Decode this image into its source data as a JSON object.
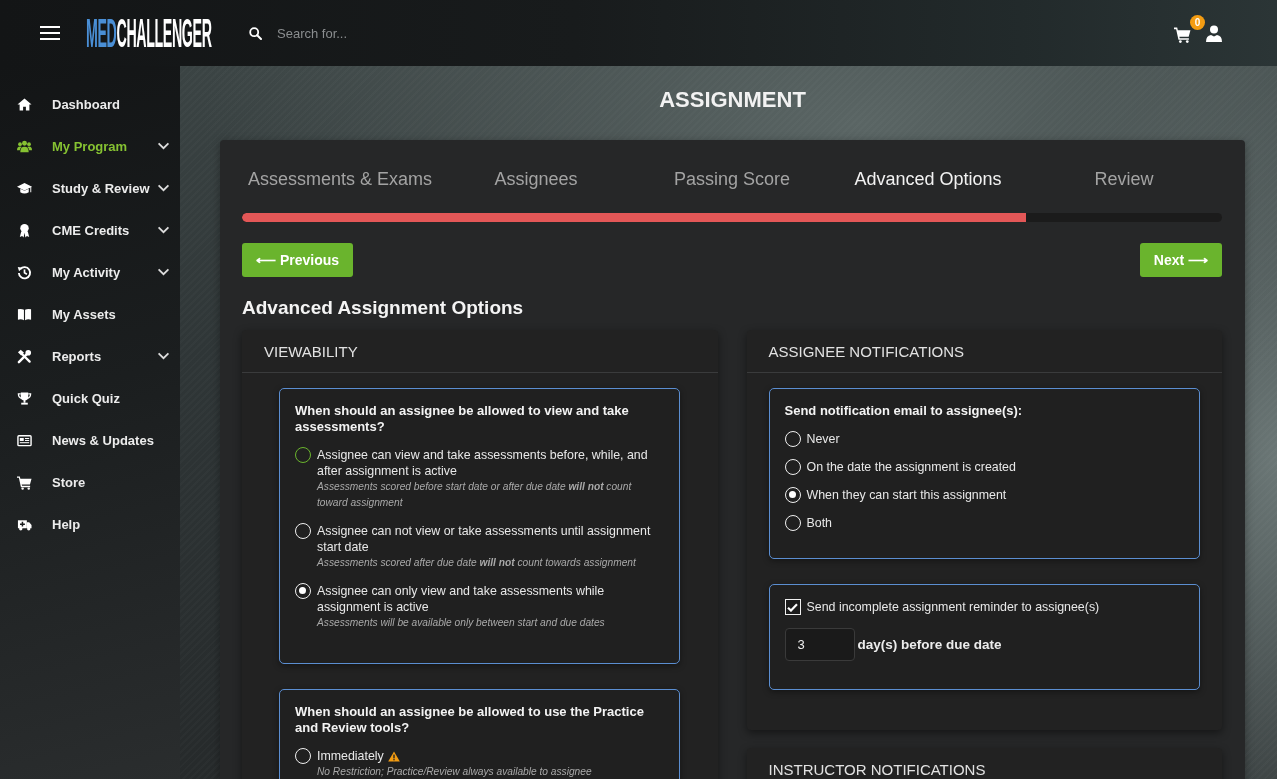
{
  "header": {
    "logo": {
      "prefix": "MED",
      "name": "CHALLENGER"
    },
    "search": {
      "placeholder": "Search for..."
    },
    "cart_badge": "0"
  },
  "sidebar": {
    "items": [
      {
        "label": "Dashboard",
        "selected": false,
        "expandable": false
      },
      {
        "label": "My Program",
        "selected": true,
        "expandable": true
      },
      {
        "label": "Study & Review",
        "selected": false,
        "expandable": true
      },
      {
        "label": "CME Credits",
        "selected": false,
        "expandable": true
      },
      {
        "label": "My Activity",
        "selected": false,
        "expandable": true
      },
      {
        "label": "My Assets",
        "selected": false,
        "expandable": false
      },
      {
        "label": "Reports",
        "selected": false,
        "expandable": true
      },
      {
        "label": "Quick Quiz",
        "selected": false,
        "expandable": false
      },
      {
        "label": "News & Updates",
        "selected": false,
        "expandable": false
      },
      {
        "label": "Store",
        "selected": false,
        "expandable": false
      },
      {
        "label": "Help",
        "selected": false,
        "expandable": false
      }
    ]
  },
  "page_title": "ASSIGNMENT",
  "wizard": {
    "tabs": [
      {
        "label": "Assessments & Exams",
        "selected": false
      },
      {
        "label": "Assignees",
        "selected": false
      },
      {
        "label": "Passing Score",
        "selected": false
      },
      {
        "label": "Advanced Options",
        "selected": true
      },
      {
        "label": "Review",
        "selected": false
      }
    ],
    "progress": {
      "level": 0.8
    },
    "previous_button": "⟵ Previous",
    "next_button": "Next ⟶"
  },
  "section_title": "Advanced Assignment Options",
  "columns": [
    {
      "panels": [
        {
          "title": "VIEWABILITY",
          "groups": [
            {
              "kind": "radio_group",
              "question": "When should an assignee be allowed to view and take assessments?",
              "options": [
                {
                  "label": "Assignee can view and take assessments before, while, and after assignment is active",
                  "note": "Assessments scored before start date or after due date **will not** count toward assignment",
                  "selected": false,
                  "color": "#6ab42d",
                  "warning": false
                },
                {
                  "label": "Assignee can not view or take assessments until assignment start date",
                  "note": "Assessments scored after due date **will not** count towards assignment",
                  "selected": false,
                  "color": "#f0f0f0",
                  "warning": false
                },
                {
                  "label": "Assignee can only view and take assessments while assignment is active",
                  "note": "Assessments will be available only between start and due dates",
                  "selected": true,
                  "color": "#f0f0f0",
                  "warning": false
                }
              ]
            },
            {
              "kind": "radio_group",
              "question": "When should an assignee be allowed to use the Practice and Review tools?",
              "options": [
                {
                  "label": "Immediately",
                  "note": "No Restriction; Practice/Review always available to assignee",
                  "selected": false,
                  "color": "#f0f0f0",
                  "warning": true
                }
              ]
            }
          ]
        }
      ]
    },
    {
      "panels": [
        {
          "title": "ASSIGNEE NOTIFICATIONS",
          "groups": [
            {
              "kind": "radio_group",
              "question": "Send notification email to assignee(s):",
              "options": [
                {
                  "label": "Never",
                  "selected": false,
                  "color": "#f0f0f0",
                  "warning": false
                },
                {
                  "label": "On the date the assignment is created",
                  "selected": false,
                  "color": "#f0f0f0",
                  "warning": false
                },
                {
                  "label": "When they can start this assignment",
                  "selected": true,
                  "color": "#f0f0f0",
                  "warning": false
                },
                {
                  "label": "Both",
                  "selected": false,
                  "color": "#f0f0f0",
                  "warning": false
                }
              ]
            },
            {
              "kind": "reminder",
              "checked": true,
              "label": "Send incomplete assignment reminder to assignee(s)",
              "days": "3",
              "suffix": "day(s) before due date"
            }
          ]
        },
        {
          "title": "INSTRUCTOR NOTIFICATIONS"
        }
      ]
    }
  ]
}
